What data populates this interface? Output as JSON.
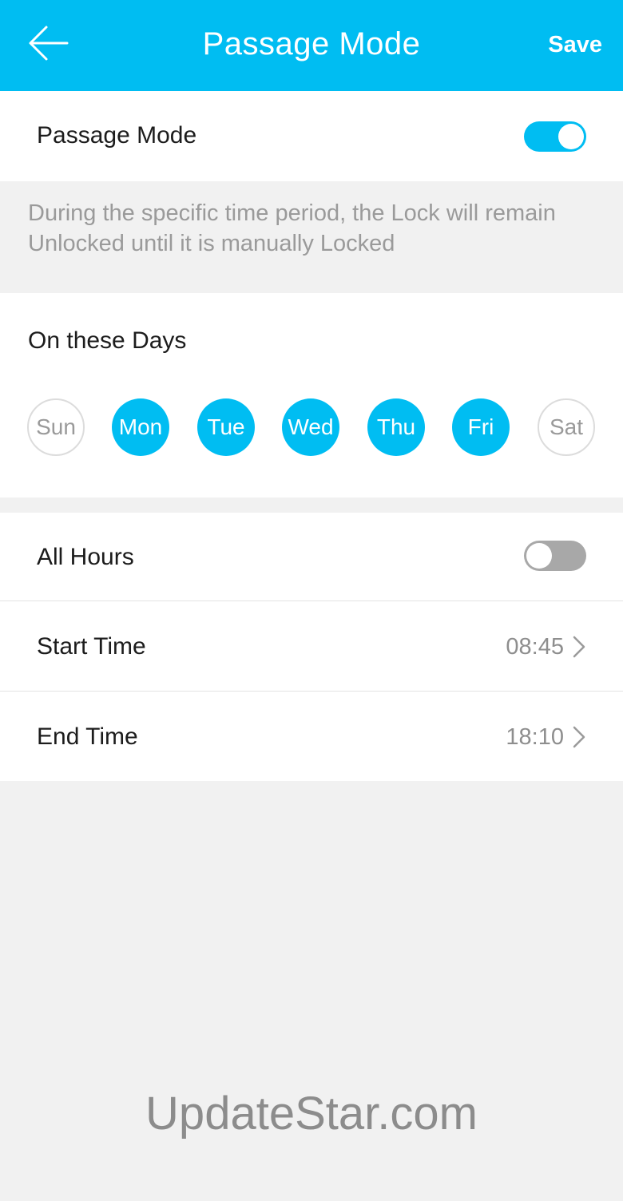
{
  "header": {
    "title": "Passage Mode",
    "save_label": "Save",
    "background_color": "#00bdf2",
    "back_icon": "arrow-left-icon"
  },
  "passage_mode": {
    "label": "Passage Mode",
    "enabled": true
  },
  "description": "During the specific time period, the Lock will remain Unlocked until it is manually Locked",
  "days": {
    "title": "On these Days",
    "items": [
      {
        "label": "Sun",
        "selected": false
      },
      {
        "label": "Mon",
        "selected": true
      },
      {
        "label": "Tue",
        "selected": true
      },
      {
        "label": "Wed",
        "selected": true
      },
      {
        "label": "Thu",
        "selected": true
      },
      {
        "label": "Fri",
        "selected": true
      },
      {
        "label": "Sat",
        "selected": false
      }
    ]
  },
  "all_hours": {
    "label": "All Hours",
    "enabled": false
  },
  "start_time": {
    "label": "Start Time",
    "value": "08:45",
    "icon": "chevron-right-icon"
  },
  "end_time": {
    "label": "End Time",
    "value": "18:10",
    "icon": "chevron-right-icon"
  },
  "watermark": "UpdateStar.com",
  "colors": {
    "accent": "#00bdf2",
    "toggle_off": "#a8a8a8",
    "background": "#f1f1f1"
  }
}
